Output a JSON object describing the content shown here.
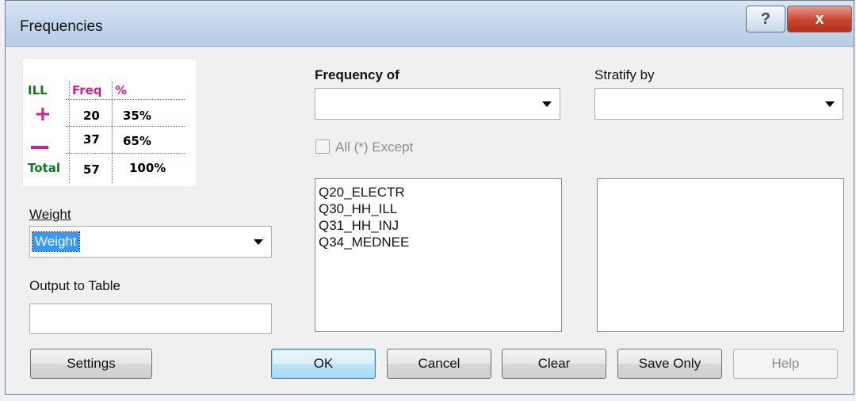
{
  "window": {
    "title": "Frequencies",
    "help_button": "?",
    "close_button": "x"
  },
  "sample_table": {
    "headers": [
      "ILL",
      "Freq",
      "%"
    ],
    "rows": [
      {
        "label": "+",
        "freq": "20",
        "pct": "35%"
      },
      {
        "label": "—",
        "freq": "37",
        "pct": "65%"
      },
      {
        "label": "Total",
        "freq": "57",
        "pct": "100%"
      }
    ]
  },
  "weight": {
    "label": "Weight",
    "value": "Weight"
  },
  "output": {
    "label": "Output to Table",
    "value": ""
  },
  "frequency_of": {
    "label": "Frequency of",
    "value": ""
  },
  "stratify_by": {
    "label": "Stratify by",
    "value": ""
  },
  "all_except": {
    "label": "All (*) Except",
    "checked": false,
    "enabled": false
  },
  "variables": [
    "Q20_ELECTR",
    "Q30_HH_ILL",
    "Q31_HH_INJ",
    "Q34_MEDNEE"
  ],
  "stratify_list": [],
  "buttons": {
    "settings": "Settings",
    "ok": "OK",
    "cancel": "Cancel",
    "clear": "Clear",
    "save_only": "Save Only",
    "help": "Help"
  }
}
